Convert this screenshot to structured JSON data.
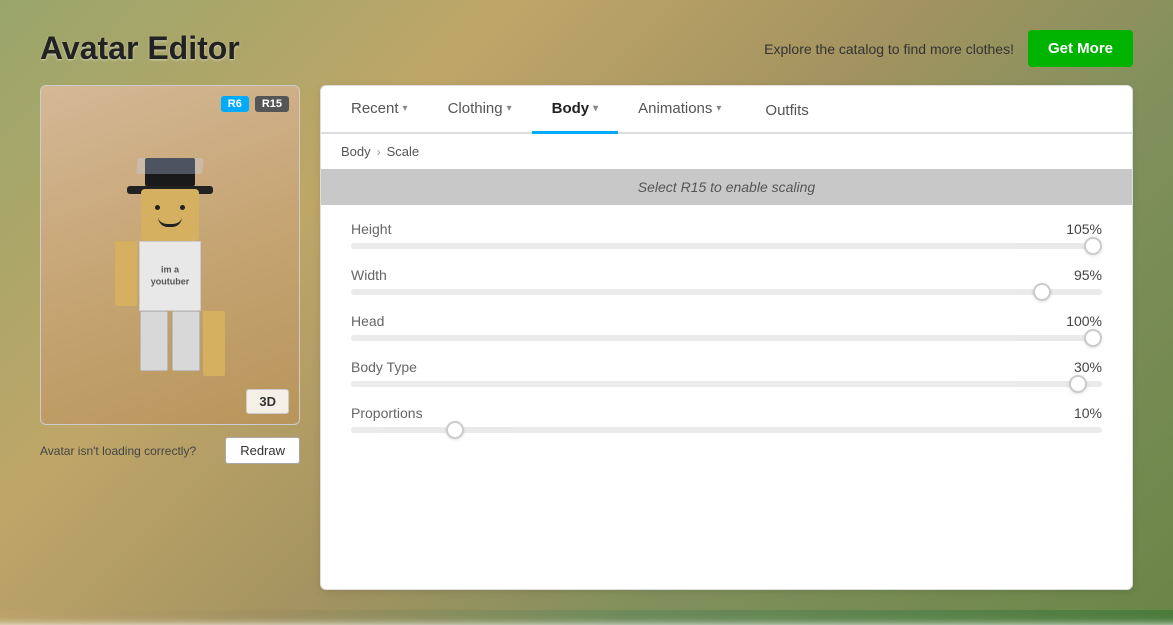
{
  "app": {
    "title": "Avatar Editor"
  },
  "header": {
    "catalog_text": "Explore the catalog to find more clothes!",
    "get_more_label": "Get More"
  },
  "avatar": {
    "rig_r6": "R6",
    "rig_r15": "R15",
    "torso_text": "im a\nyoutuber",
    "view_3d_label": "3D",
    "loading_message": "Avatar isn't loading correctly?",
    "redraw_label": "Redraw"
  },
  "tabs": [
    {
      "id": "recent",
      "label": "Recent",
      "has_chevron": true,
      "active": false
    },
    {
      "id": "clothing",
      "label": "Clothing",
      "has_chevron": true,
      "active": false
    },
    {
      "id": "body",
      "label": "Body",
      "has_chevron": true,
      "active": true
    },
    {
      "id": "animations",
      "label": "Animations",
      "has_chevron": true,
      "active": false
    },
    {
      "id": "outfits",
      "label": "Outfits",
      "has_chevron": false,
      "active": false
    }
  ],
  "breadcrumb": {
    "level1": "Body",
    "separator": "›",
    "level2": "Scale"
  },
  "scale": {
    "disabled_message": "Select R15 to enable scaling",
    "sliders": [
      {
        "id": "height",
        "label": "Height",
        "value": 105,
        "display": "105%",
        "percent": 105
      },
      {
        "id": "width",
        "label": "Width",
        "value": 95,
        "display": "95%",
        "percent": 95
      },
      {
        "id": "head",
        "label": "Head",
        "value": 100,
        "display": "100%",
        "percent": 100
      },
      {
        "id": "body-type",
        "label": "Body Type",
        "value": 30,
        "display": "30%",
        "percent": 30
      },
      {
        "id": "proportions",
        "label": "Proportions",
        "value": 10,
        "display": "10%",
        "percent": 10
      }
    ]
  },
  "colors": {
    "active_tab_underline": "#00aaff",
    "get_more_bg": "#00b300",
    "badge_r6_bg": "#00aaff"
  }
}
